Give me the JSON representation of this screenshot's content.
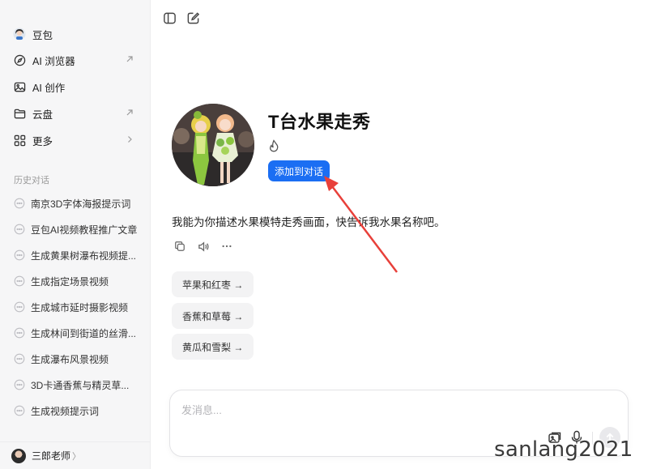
{
  "sidebar": {
    "nav": [
      {
        "label": "豆包",
        "icon": "doubao-avatar-icon",
        "external": false
      },
      {
        "label": "AI 浏览器",
        "icon": "compass-icon",
        "external": true
      },
      {
        "label": "AI 创作",
        "icon": "image-icon",
        "external": false
      },
      {
        "label": "云盘",
        "icon": "folder-icon",
        "external": true
      },
      {
        "label": "更多",
        "icon": "grid-icon",
        "chevron": true
      }
    ],
    "history_label": "历史对话",
    "history": [
      "南京3D字体海报提示词",
      "豆包AI视频教程推广文章",
      "生成黄果树瀑布视频提...",
      "生成指定场景视频",
      "生成城市延时摄影视频",
      "生成林间到街道的丝滑...",
      "生成瀑布风景视频",
      "3D卡通香蕉与精灵草...",
      "生成视频提示词"
    ],
    "user": {
      "name": "三郎老师",
      "chevron": "〉"
    }
  },
  "toolbar": {
    "icons": [
      "sidebar-toggle-icon",
      "new-chat-icon"
    ]
  },
  "bot": {
    "title": "T台水果走秀",
    "hot_icon": "fire-icon",
    "add_button": "添加到对话",
    "intro": "我能为你描述水果模特走秀画面，快告诉我水果名称吧。",
    "actions": [
      "copy-icon",
      "speaker-icon",
      "more-icon"
    ],
    "suggestions": [
      "苹果和红枣 →",
      "香蕉和草莓 →",
      "黄瓜和雪梨 →"
    ]
  },
  "composer": {
    "placeholder": "发消息..."
  },
  "colors": {
    "accent": "#1b6ef3",
    "annotation": "#e8403a",
    "sidebar_bg": "#f6f6f7"
  },
  "watermark": "sanlang2021"
}
